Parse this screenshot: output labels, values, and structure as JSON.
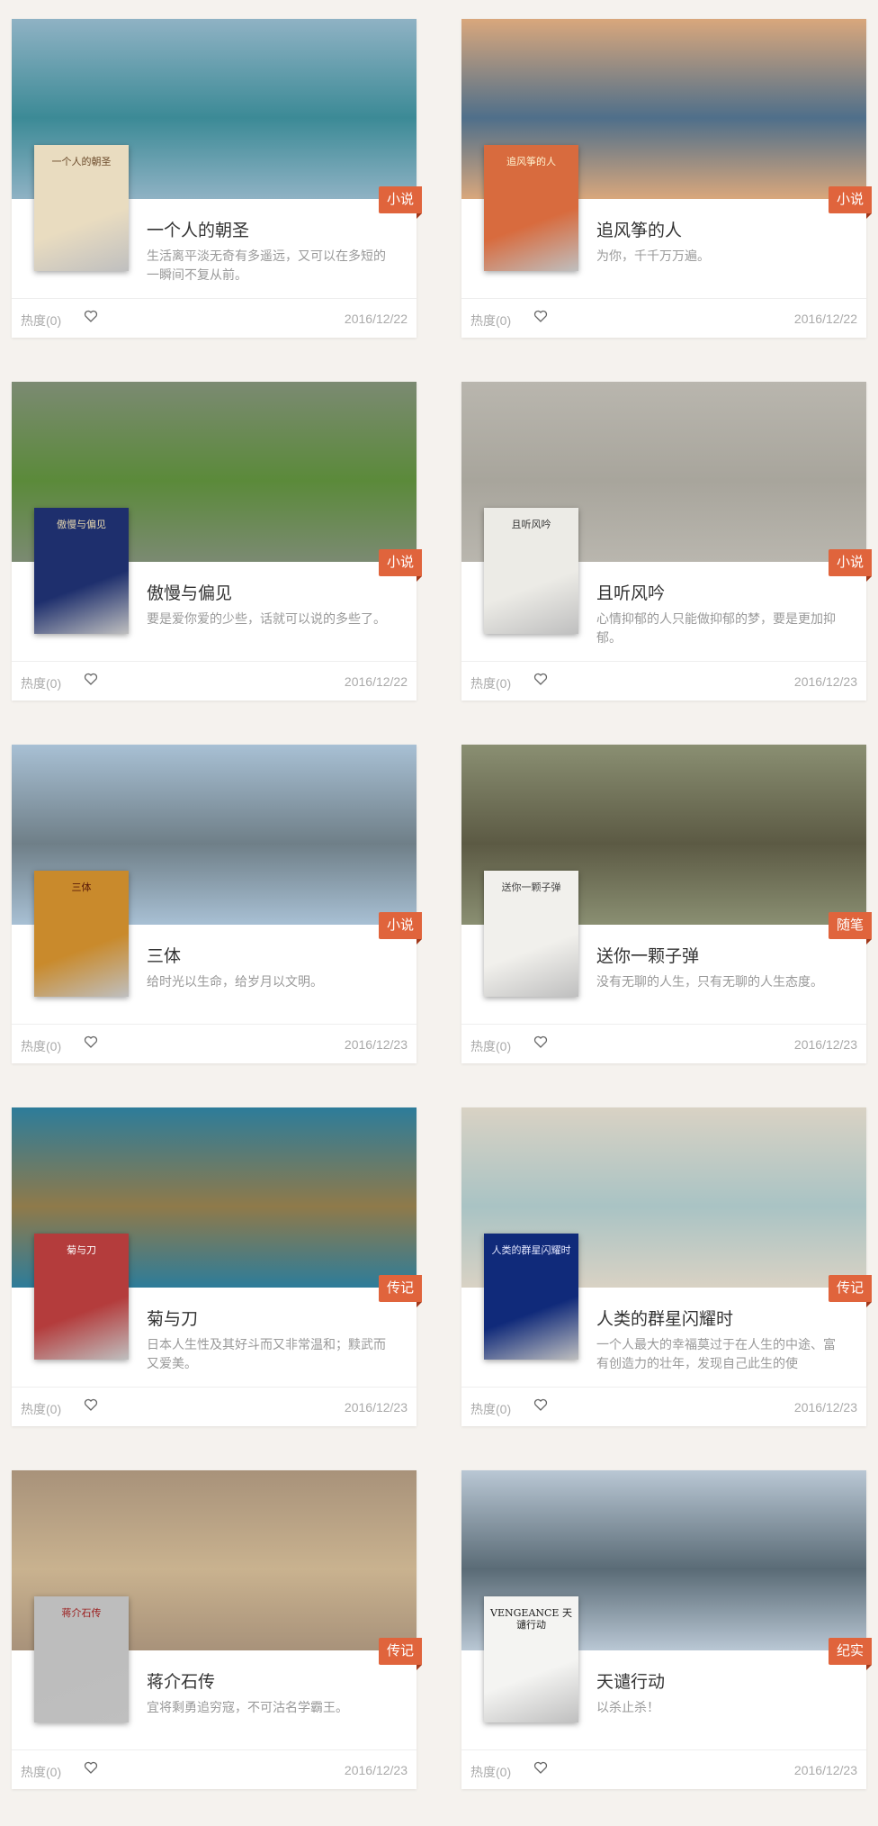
{
  "accent": "#e0643c",
  "heart_icon": "heart-outline-icon",
  "cards": [
    {
      "title": "一个人的朝圣",
      "desc": "生活离平淡无奇有多遥远，又可以在多短的一瞬间不复从前。",
      "tag": "小说",
      "heat": "热度(0)",
      "date": "2016/12/22",
      "cover_text": "一个人的朝圣"
    },
    {
      "title": "追风筝的人",
      "desc": "为你，千千万万遍。",
      "tag": "小说",
      "heat": "热度(0)",
      "date": "2016/12/22",
      "cover_text": "追风筝的人"
    },
    {
      "title": "傲慢与偏见",
      "desc": "要是爱你爱的少些，话就可以说的多些了。",
      "tag": "小说",
      "heat": "热度(0)",
      "date": "2016/12/22",
      "cover_text": "傲慢与偏见"
    },
    {
      "title": "且听风吟",
      "desc": "心情抑郁的人只能做抑郁的梦，要是更加抑郁。",
      "tag": "小说",
      "heat": "热度(0)",
      "date": "2016/12/23",
      "cover_text": "且听风吟"
    },
    {
      "title": "三体",
      "desc": "给时光以生命，给岁月以文明。",
      "tag": "小说",
      "heat": "热度(0)",
      "date": "2016/12/23",
      "cover_text": "三体"
    },
    {
      "title": "送你一颗子弹",
      "desc": "没有无聊的人生，只有无聊的人生态度。",
      "tag": "随笔",
      "heat": "热度(0)",
      "date": "2016/12/23",
      "cover_text": "送你一颗子弹"
    },
    {
      "title": "菊与刀",
      "desc": "日本人生性及其好斗而又非常温和；黩武而又爱美。",
      "tag": "传记",
      "heat": "热度(0)",
      "date": "2016/12/23",
      "cover_text": "菊与刀"
    },
    {
      "title": "人类的群星闪耀时",
      "desc": "一个人最大的幸福莫过于在人生的中途、富有创造力的壮年，发现自己此生的使",
      "tag": "传记",
      "heat": "热度(0)",
      "date": "2016/12/23",
      "cover_text": "人类的群星闪耀时"
    },
    {
      "title": "蒋介石传",
      "desc": "宜将剩勇追穷寇，不可沽名学霸王。",
      "tag": "传记",
      "heat": "热度(0)",
      "date": "2016/12/23",
      "cover_text": "蒋介石传"
    },
    {
      "title": "天谴行动",
      "desc": "以杀止杀！",
      "tag": "纪实",
      "heat": "热度(0)",
      "date": "2016/12/23",
      "cover_text": "VENGEANCE 天谴行动"
    }
  ]
}
